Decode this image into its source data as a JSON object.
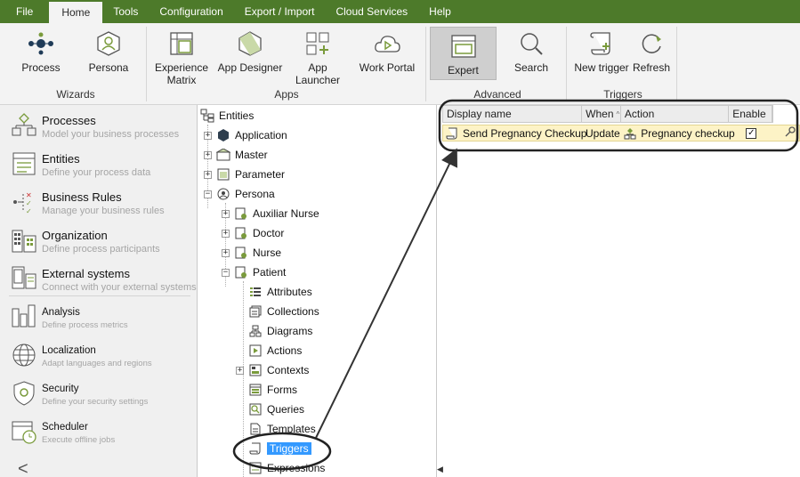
{
  "menubar": {
    "items": [
      "File",
      "Home",
      "Tools",
      "Configuration",
      "Export / Import",
      "Cloud Services",
      "Help"
    ]
  },
  "ribbon": {
    "buttons": {
      "process": "Process",
      "persona": "Persona",
      "experience_matrix_1": "Experience",
      "experience_matrix_2": "Matrix",
      "app_designer": "App Designer",
      "app_launcher": "App Launcher",
      "work_portal": "Work Portal",
      "expert": "Expert",
      "search": "Search",
      "new_trigger": "New trigger",
      "refresh": "Refresh"
    },
    "groups": {
      "wizards": "Wizards",
      "apps": "Apps",
      "advanced": "Advanced",
      "triggers": "Triggers"
    }
  },
  "sidebar": {
    "items": [
      {
        "title": "Processes",
        "desc": "Model your business processes",
        "icon": "processes-icon"
      },
      {
        "title": "Entities",
        "desc": "Define your process data",
        "icon": "entities-icon"
      },
      {
        "title": "Business Rules",
        "desc": "Manage your business rules",
        "icon": "business-rules-icon"
      },
      {
        "title": "Organization",
        "desc": "Define process participants",
        "icon": "organization-icon"
      },
      {
        "title": "External systems",
        "desc": "Connect with your external systems",
        "icon": "external-systems-icon"
      },
      {
        "title": "Analysis",
        "desc": "Define process metrics",
        "icon": "analysis-icon"
      },
      {
        "title": "Localization",
        "desc": "Adapt languages and regions",
        "icon": "localization-icon"
      },
      {
        "title": "Security",
        "desc": "Define your security settings",
        "icon": "security-icon"
      },
      {
        "title": "Scheduler",
        "desc": "Execute offline jobs",
        "icon": "scheduler-icon"
      }
    ],
    "collapse": "<"
  },
  "tree": {
    "root": "Entities",
    "application": "Application",
    "master": "Master",
    "parameter": "Parameter",
    "persona": "Persona",
    "auxiliar_nurse": "Auxiliar Nurse",
    "doctor": "Doctor",
    "nurse": "Nurse",
    "patient": "Patient",
    "attributes": "Attributes",
    "collections": "Collections",
    "diagrams": "Diagrams",
    "actions": "Actions",
    "contexts": "Contexts",
    "forms": "Forms",
    "queries": "Queries",
    "templates": "Templates",
    "triggers": "Triggers",
    "expressions": "Expressions"
  },
  "grid": {
    "headers": {
      "display_name": "Display name",
      "when": "When",
      "when_sort": "^",
      "action": "Action",
      "enable": "Enable"
    },
    "rows": [
      {
        "display_name": "Send Pregnancy Checkup",
        "when": "Update",
        "action": "Pregnancy checkup",
        "enable": "✓"
      }
    ]
  },
  "colors": {
    "menubar": "#4d7a2a",
    "selection": "#3399ff",
    "row_highlight": "#fdf3c6",
    "accent_green": "#7a9b3c"
  }
}
